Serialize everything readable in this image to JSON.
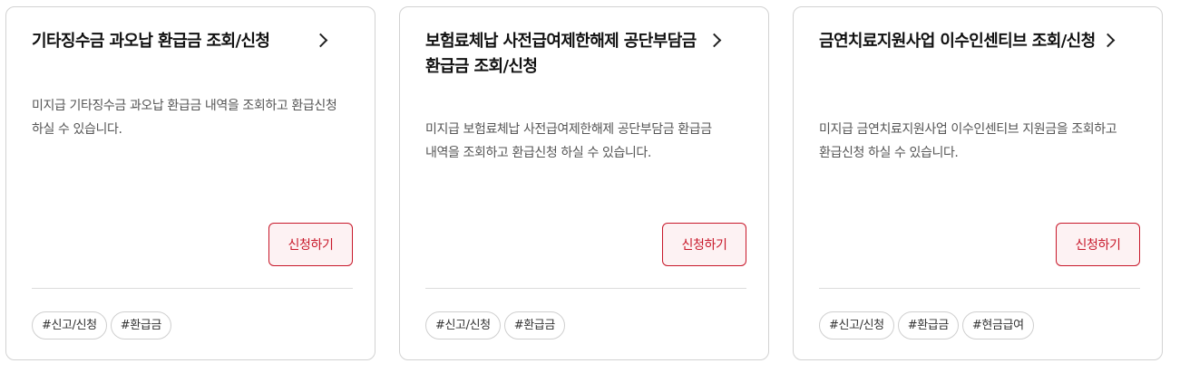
{
  "cards": [
    {
      "title": "기타징수금 과오납 환급금 조회/신청",
      "description": "미지급 기타징수금 과오납 환급금 내역을 조회하고 환급신청 하실 수 있습니다.",
      "button_label": "신청하기",
      "tags": [
        "#신고/신청",
        "#환급금"
      ],
      "chevron_icon": "chevron-right-icon"
    },
    {
      "title": "보험료체납 사전급여제한해제 공단부담금 환급금 조회/신청",
      "description": "미지급 보험료체납 사전급여제한해제 공단부담금 환급금 내역을 조회하고 환급신청 하실 수 있습니다.",
      "button_label": "신청하기",
      "tags": [
        "#신고/신청",
        "#환급금"
      ],
      "chevron_icon": "chevron-right-icon"
    },
    {
      "title": "금연치료지원사업 이수인센티브 조회/신청",
      "description": "미지급 금연치료지원사업 이수인센티브 지원금을 조회하고 환급신청 하실 수 있습니다.",
      "button_label": "신청하기",
      "tags": [
        "#신고/신청",
        "#환급금",
        "#현금급여"
      ],
      "chevron_icon": "chevron-right-icon"
    }
  ],
  "colors": {
    "accent": "#c8182a",
    "accent_bg": "#fdf2f3",
    "border": "#d2d2d2",
    "title": "#111111",
    "description": "#555555"
  }
}
